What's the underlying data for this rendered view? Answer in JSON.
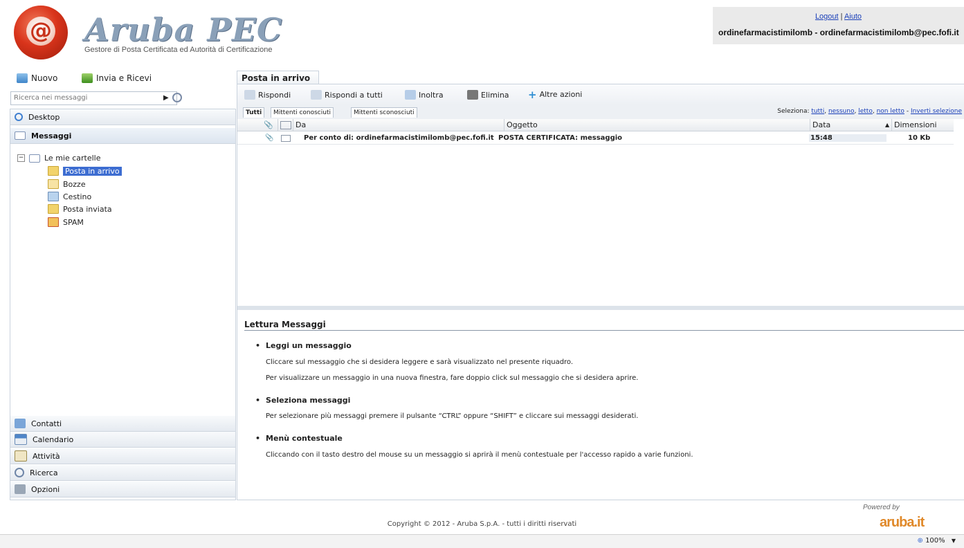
{
  "header": {
    "brand": "Aruba PEC",
    "tagline": "Gestore di Posta Certificata ed Autorità di Certificazione",
    "logout": "Logout",
    "separator": "|",
    "help": "Aiuto",
    "user": "ordinefarmacistimilomb - ordinefarmacistimilomb@pec.fofi.it"
  },
  "left_toolbar": {
    "new": "Nuovo",
    "send_receive": "Invia e Ricevi"
  },
  "search": {
    "placeholder": "Ricerca nei messaggi"
  },
  "nav": {
    "desktop": "Desktop",
    "messages": "Messaggi",
    "contacts": "Contatti",
    "calendar": "Calendario",
    "activities": "Attività",
    "search": "Ricerca",
    "options": "Opzioni"
  },
  "folders": {
    "root": "Le mie cartelle",
    "items": [
      "Posta in arrivo",
      "Bozze",
      "Cestino",
      "Posta inviata",
      "SPAM"
    ]
  },
  "main": {
    "tab": "Posta in arrivo",
    "actions": [
      "Rispondi",
      "Rispondi a tutti",
      "Inoltra",
      "Elimina",
      "Altre azioni"
    ],
    "filters": [
      "Tutti",
      "Mittenti conosciuti",
      "Mittenti sconosciuti"
    ],
    "select_label": "Seleziona:",
    "select_links": {
      "all": "tutti",
      "none": "nessuno",
      "read": "letto",
      "unread": "non letto",
      "invert": "Inverti selezione"
    },
    "columns": {
      "from": "Da",
      "subject": "Oggetto",
      "date": "Data",
      "size": "Dimensioni"
    },
    "messages": [
      {
        "from": "Per conto di: ordinefarmacistimilomb@pec.fofi.it",
        "subject": "POSTA CERTIFICATA: messaggio",
        "date": "15:48",
        "size": "10 Kb"
      }
    ]
  },
  "reading": {
    "title": "Lettura Messaggi",
    "sections": [
      {
        "heading": "Leggi un messaggio",
        "lines": [
          "Cliccare sul messaggio che si desidera leggere e sarà visualizzato nel presente riquadro.",
          "Per visualizzare un messaggio in una nuova finestra, fare doppio click sul messaggio che si desidera aprire."
        ]
      },
      {
        "heading": "Seleziona messaggi",
        "lines": [
          "Per selezionare più messaggi premere il pulsante “CTRL” oppure “SHIFT” e cliccare sui messaggi desiderati."
        ]
      },
      {
        "heading": "Menù contestuale",
        "lines": [
          "Cliccando con il tasto destro del mouse su un messaggio si aprirà il menù contestuale per l'accesso rapido a varie funzioni."
        ]
      }
    ]
  },
  "footer": {
    "copyright": "Copyright © 2012 - Aruba S.p.A. - tutti i diritti riservati",
    "powered": "Powered by",
    "aruba_logo": "aruba.it",
    "zoom": "100%"
  },
  "icons": {
    "new": "new-mail-icon",
    "send_receive": "send-receive-icon",
    "search": "magnifier-icon",
    "desktop": "desktop-icon",
    "messages": "envelope-icon",
    "contacts": "address-book-icon",
    "calendar": "calendar-icon",
    "activities": "tasks-icon",
    "find": "search-icon",
    "options": "options-icon"
  },
  "colors": {
    "selection": "#3d6dd1",
    "link": "#1a3fb8",
    "brand_red": "#d9341b",
    "brand_orange": "#e0892a"
  }
}
